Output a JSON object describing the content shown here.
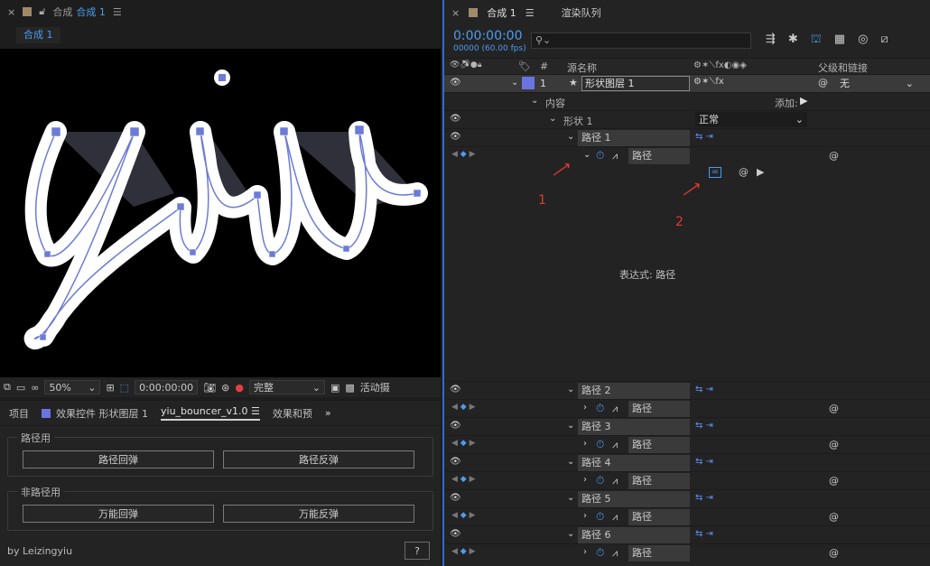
{
  "comp_panel": {
    "title": "合成",
    "comp_name": "合成 1",
    "sub_tab": "合成 1",
    "viewer_text": "yiu",
    "zoom": "50%",
    "timecode": "0:00:00:00",
    "resolution": "完整",
    "active_camera": "活动摄"
  },
  "fx_panel": {
    "tabs": [
      "项目",
      "效果控件 形状图层 1",
      "yiu_bouncer_v1.0",
      "效果和预"
    ],
    "group1_title": "路径用",
    "group1_btn1": "路径回弹",
    "group1_btn2": "路径反弹",
    "group2_title": "非路径用",
    "group2_btn1": "万能回弹",
    "group2_btn2": "万能反弹",
    "footer": "by Leizingyiu",
    "help": "?"
  },
  "timeline": {
    "tab1": "合成 1",
    "tab2": "渲染队列",
    "timecode": "0:00:00:00",
    "frames": "00000 (60.00 fps)",
    "col_num": "#",
    "col_source": "源名称",
    "col_parent": "父级和链接",
    "layer_num": "1",
    "layer_name": "形状图层 1",
    "parent_value": "无",
    "contents": "内容",
    "add_label": "添加:",
    "shape_group": "形状 1",
    "blend_mode": "正常",
    "path1": "路径 1",
    "path_prop": "路径",
    "expression_label": "表达式: 路径",
    "annotation1": "1",
    "annotation2": "2",
    "paths": [
      {
        "name": "路径 2",
        "prop": "路径"
      },
      {
        "name": "路径 3",
        "prop": "路径"
      },
      {
        "name": "路径 4",
        "prop": "路径"
      },
      {
        "name": "路径 5",
        "prop": "路径"
      },
      {
        "name": "路径 6",
        "prop": "路径"
      }
    ]
  }
}
